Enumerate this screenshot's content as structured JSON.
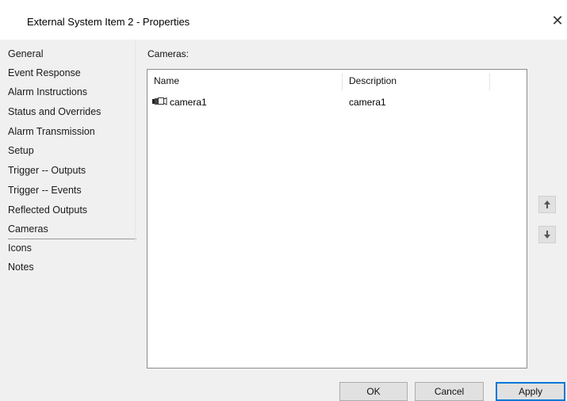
{
  "window": {
    "title": "External System Item 2 - Properties",
    "close_symbol": "✕"
  },
  "sidebar": {
    "items": [
      {
        "label": "General"
      },
      {
        "label": "Event Response"
      },
      {
        "label": "Alarm Instructions"
      },
      {
        "label": "Status and Overrides"
      },
      {
        "label": "Alarm Transmission"
      },
      {
        "label": "Setup"
      },
      {
        "label": "Trigger -- Outputs"
      },
      {
        "label": "Trigger -- Events"
      },
      {
        "label": "Reflected Outputs"
      },
      {
        "label": "Cameras"
      },
      {
        "label": "Icons"
      },
      {
        "label": "Notes"
      }
    ],
    "selected": "Cameras"
  },
  "main": {
    "section_label": "Cameras:",
    "columns": [
      "Name",
      "Description"
    ],
    "rows": [
      {
        "name": "camera1",
        "description": "camera1",
        "icon": "camera-icon"
      }
    ]
  },
  "reorder": {
    "up_icon": "arrow-up-icon",
    "down_icon": "arrow-down-icon"
  },
  "buttons": {
    "ok": "OK",
    "cancel": "Cancel",
    "apply": "Apply"
  }
}
